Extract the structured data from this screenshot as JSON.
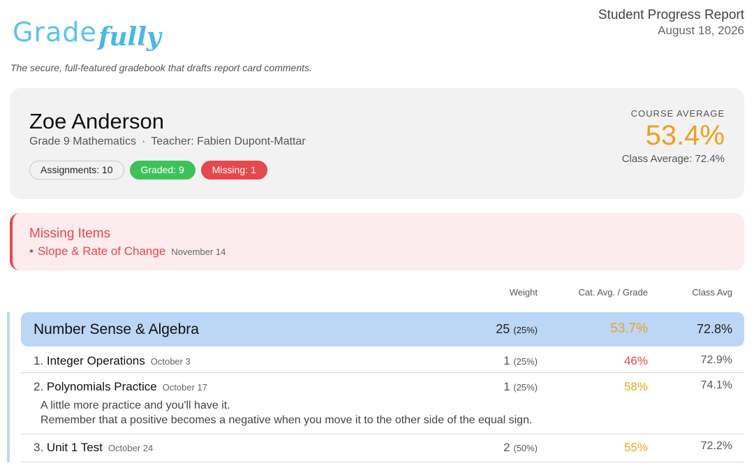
{
  "header": {
    "logo_part1": "Grade",
    "logo_part2": "fully",
    "tagline": "The secure, full-featured gradebook that drafts report card comments.",
    "report_title": "Student Progress Report",
    "report_date": "August 18, 2026"
  },
  "student": {
    "name": "Zoe Anderson",
    "course": "Grade 9 Mathematics",
    "separator": "·",
    "teacher": "Teacher: Fabien Dupont-Mattar",
    "pills": {
      "assignments": "Assignments: 10",
      "graded": "Graded: 9",
      "missing": "Missing: 1"
    },
    "course_average_label": "COURSE AVERAGE",
    "course_average_value": "53.4%",
    "class_average": "Class Average: 72.4%"
  },
  "missing_items": {
    "title": "Missing Items",
    "items": [
      {
        "bullet": "•",
        "name": "Slope & Rate of Change",
        "date": "November 14"
      }
    ]
  },
  "table": {
    "headers": {
      "weight": "Weight",
      "cat_avg": "Cat. Avg. / Grade",
      "class_avg": "Class Avg"
    },
    "categories": [
      {
        "name": "Number Sense & Algebra",
        "weight": "25",
        "weight_pct": "(25%)",
        "avg": "53.7%",
        "class_avg": "72.8%",
        "items": [
          {
            "num": "1.",
            "name": "Integer Operations",
            "date": "October 3",
            "weight": "1",
            "weight_pct": "(25%)",
            "grade": "46%",
            "class_avg": "72.9%"
          },
          {
            "num": "2.",
            "name": "Polynomials Practice",
            "date": "October 17",
            "weight": "1",
            "weight_pct": "(25%)",
            "grade": "58%",
            "class_avg": "74.1%",
            "comment_line1": "A little more practice and you'll have it.",
            "comment_line2": "Remember that a positive becomes a negative when you move it to the other side of the equal sign."
          },
          {
            "num": "3.",
            "name": "Unit 1 Test",
            "date": "October 24",
            "weight": "2",
            "weight_pct": "(50%)",
            "grade": "55%",
            "class_avg": "72.2%"
          }
        ]
      }
    ]
  },
  "colors": {
    "accent_orange": "#f0a01e",
    "grade_red": "#e5484d",
    "grade_amber": "#e6a817",
    "missing_red": "#e5484d",
    "graded_green": "#3cc25a",
    "category_blue": "#bcd6f5",
    "logo_blue": "#5cc3ea"
  }
}
